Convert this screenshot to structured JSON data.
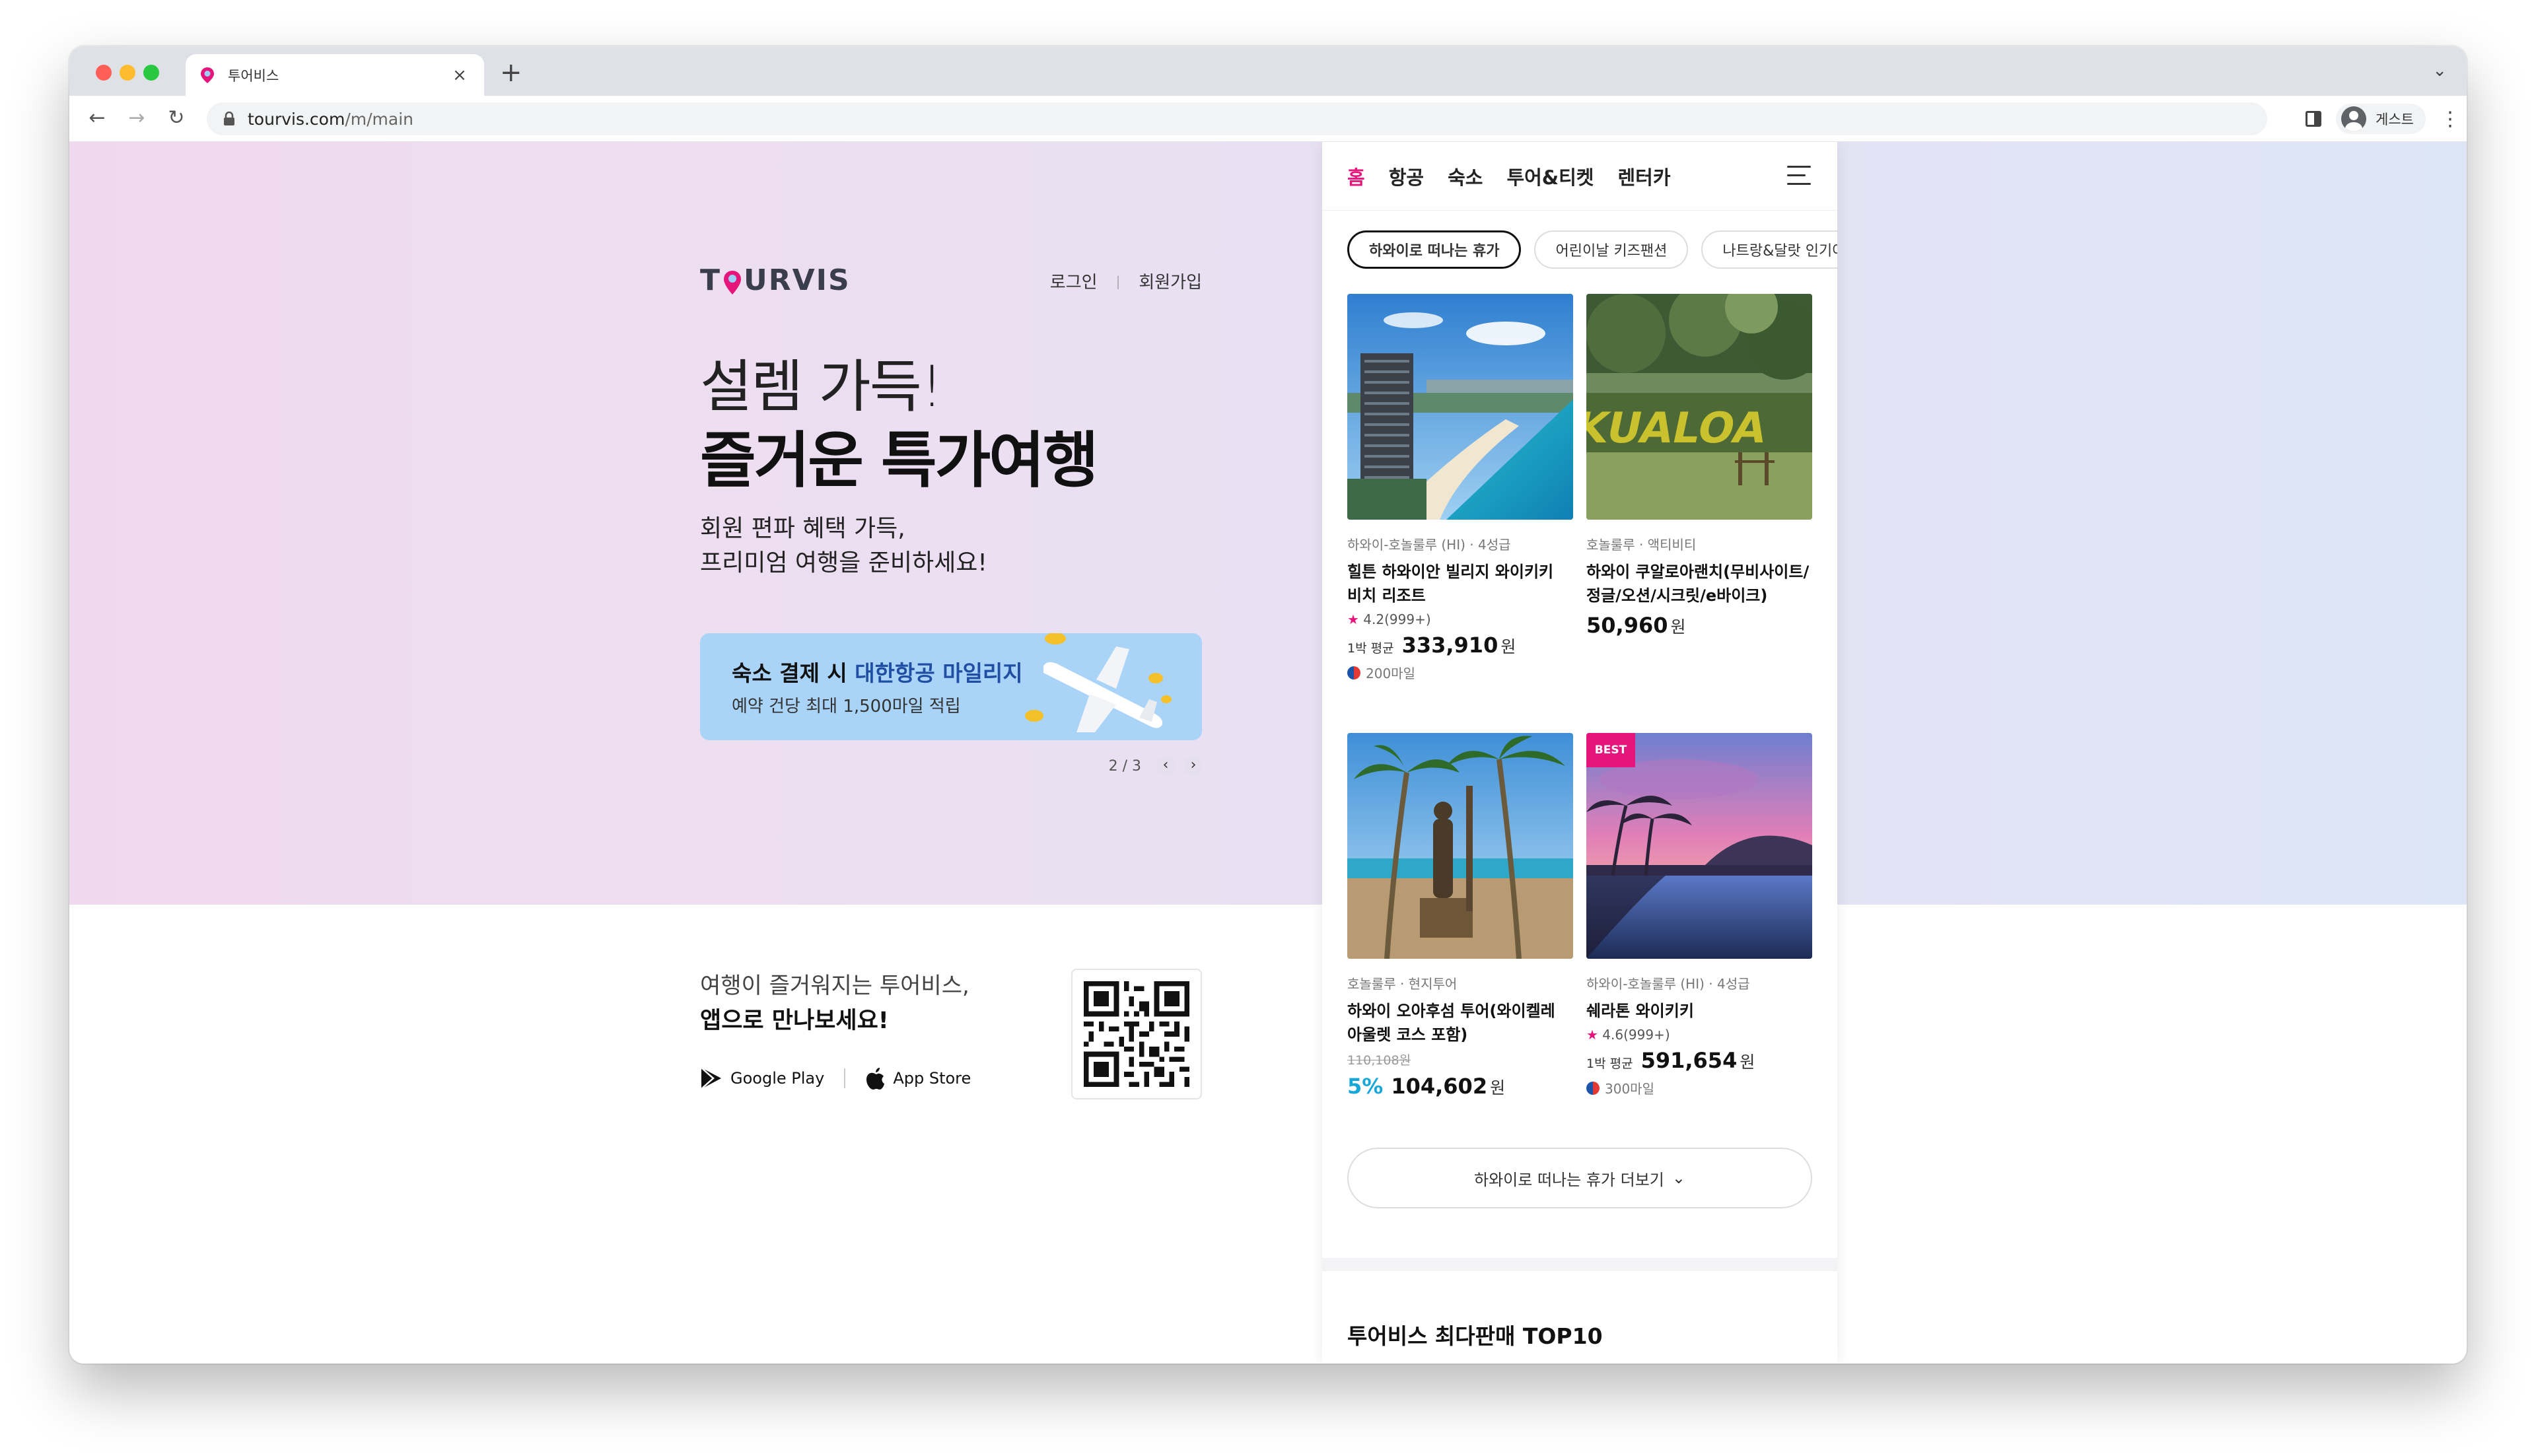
{
  "browser": {
    "tab_title": "투어비스",
    "new_tab": "+",
    "tab_close": "×",
    "url_host": "tourvis.com",
    "url_path": "/m/main",
    "profile_label": "게스트"
  },
  "desktop": {
    "logo": "TOURVIS",
    "login": "로그인",
    "signup": "회원가입",
    "headline_1": "설렘 가득!",
    "headline_2": "즐거운 특가여행",
    "sub_1": "회원 편파 혜택 가득,",
    "sub_2": "프리미엄 여행을 준비하세요!",
    "promo": {
      "title_prefix": "숙소 결제 시 ",
      "title_highlight": "대한항공 마일리지",
      "desc": "예약 건당 최대 1,500마일 적립"
    },
    "pager": {
      "current": "2",
      "total": "3",
      "sep": " / ",
      "prev": "‹",
      "next": "›"
    },
    "app_text_1": "여행이 즐거워지는 투어비스,",
    "app_text_2": "앱으로 만나보세요!",
    "google_play": "Google Play",
    "app_store": "App Store"
  },
  "mobile": {
    "nav": [
      {
        "label": "홈",
        "active": true
      },
      {
        "label": "항공",
        "active": false
      },
      {
        "label": "숙소",
        "active": false
      },
      {
        "label": "투어&티켓",
        "active": false
      },
      {
        "label": "렌터카",
        "active": false
      }
    ],
    "chips": [
      {
        "label": "하와이로 떠나는 휴가",
        "active": true
      },
      {
        "label": "어린이날 키즈팬션",
        "active": false
      },
      {
        "label": "나트랑&달랏 인기여행",
        "active": false
      }
    ],
    "products": [
      {
        "meta": "하와이-호놀룰루 (HI) · 4성급",
        "name": "힐튼 하와이안 빌리지 와이키키 비치 리조트",
        "rating": "4.2",
        "reviews": "(999+)",
        "price_label": "1박 평균",
        "price": "333,910",
        "unit": "원",
        "mileage": "200마일"
      },
      {
        "meta": "호놀룰루 · 액티비티",
        "name": "하와이 쿠알로아랜치(무비사이트/정글/오션/시크릿/e바이크)",
        "price": "50,960",
        "unit": "원"
      },
      {
        "meta": "호놀룰루 · 현지투어",
        "name": "하와이 오아후섬 투어(와이켈레 아울렛 코스 포함)",
        "orig_price": "110,108원",
        "discount": "5%",
        "price": "104,602",
        "unit": "원"
      },
      {
        "badge": "BEST",
        "meta": "하와이-호놀룰루 (HI) · 4성급",
        "name": "쉐라톤 와이키키",
        "rating": "4.6",
        "reviews": "(999+)",
        "price_label": "1박 평균",
        "price": "591,654",
        "unit": "원",
        "mileage": "300마일"
      }
    ],
    "more_button": "하와이로 떠나는 휴가 더보기",
    "top10_title": "투어비스 최다판매 TOP10"
  },
  "colors": {
    "accent_pink": "#e6157c",
    "korean_air_blue": "#1f4ea3",
    "discount_blue": "#18a7d8",
    "promo_bg": "#a9d3f7"
  }
}
